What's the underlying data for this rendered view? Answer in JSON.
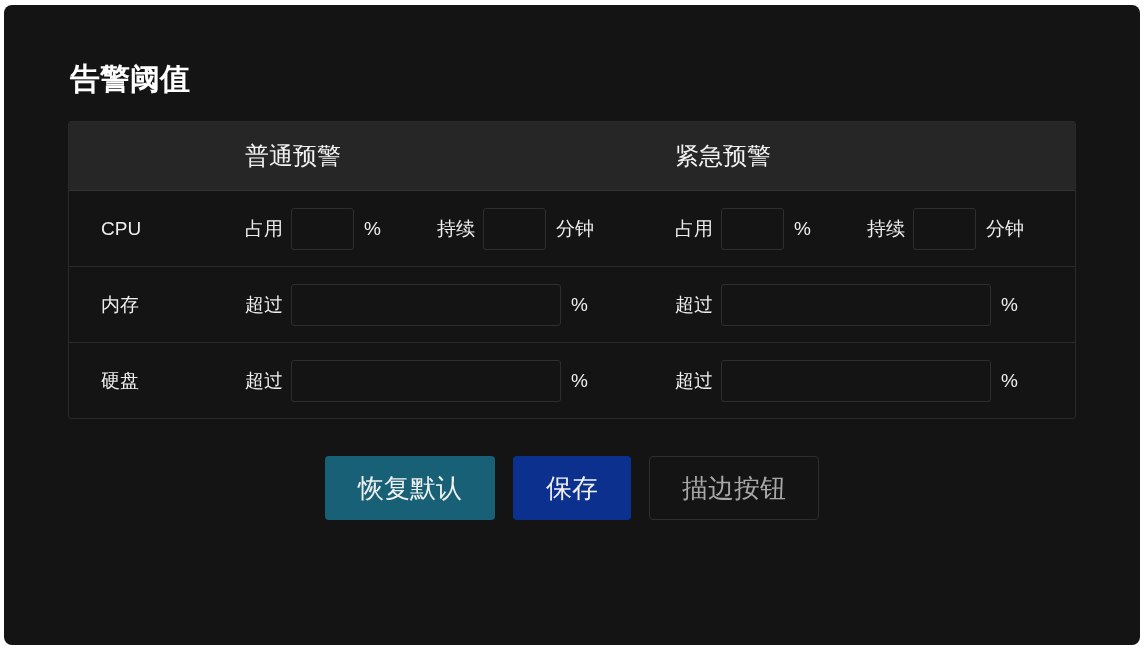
{
  "title": "告警阈值",
  "columns": [
    "普通预警",
    "紧急预警"
  ],
  "rows": [
    {
      "label": "CPU",
      "kind": "pair",
      "cells": [
        {
          "fields": [
            {
              "label": "占用",
              "unit": "%"
            },
            {
              "label": "持续",
              "unit": "分钟"
            }
          ]
        },
        {
          "fields": [
            {
              "label": "占用",
              "unit": "%"
            },
            {
              "label": "持续",
              "unit": "分钟"
            }
          ]
        }
      ]
    },
    {
      "label": "内存",
      "kind": "single",
      "cells": [
        {
          "fields": [
            {
              "label": "超过",
              "unit": "%"
            }
          ]
        },
        {
          "fields": [
            {
              "label": "超过",
              "unit": "%"
            }
          ]
        }
      ]
    },
    {
      "label": "硬盘",
      "kind": "single",
      "cells": [
        {
          "fields": [
            {
              "label": "超过",
              "unit": "%"
            }
          ]
        },
        {
          "fields": [
            {
              "label": "超过",
              "unit": "%"
            }
          ]
        }
      ]
    }
  ],
  "buttons": [
    {
      "label": "恢复默认",
      "kind": "secondary"
    },
    {
      "label": "保存",
      "kind": "primary"
    },
    {
      "label": "描边按钮",
      "kind": "outline"
    }
  ]
}
